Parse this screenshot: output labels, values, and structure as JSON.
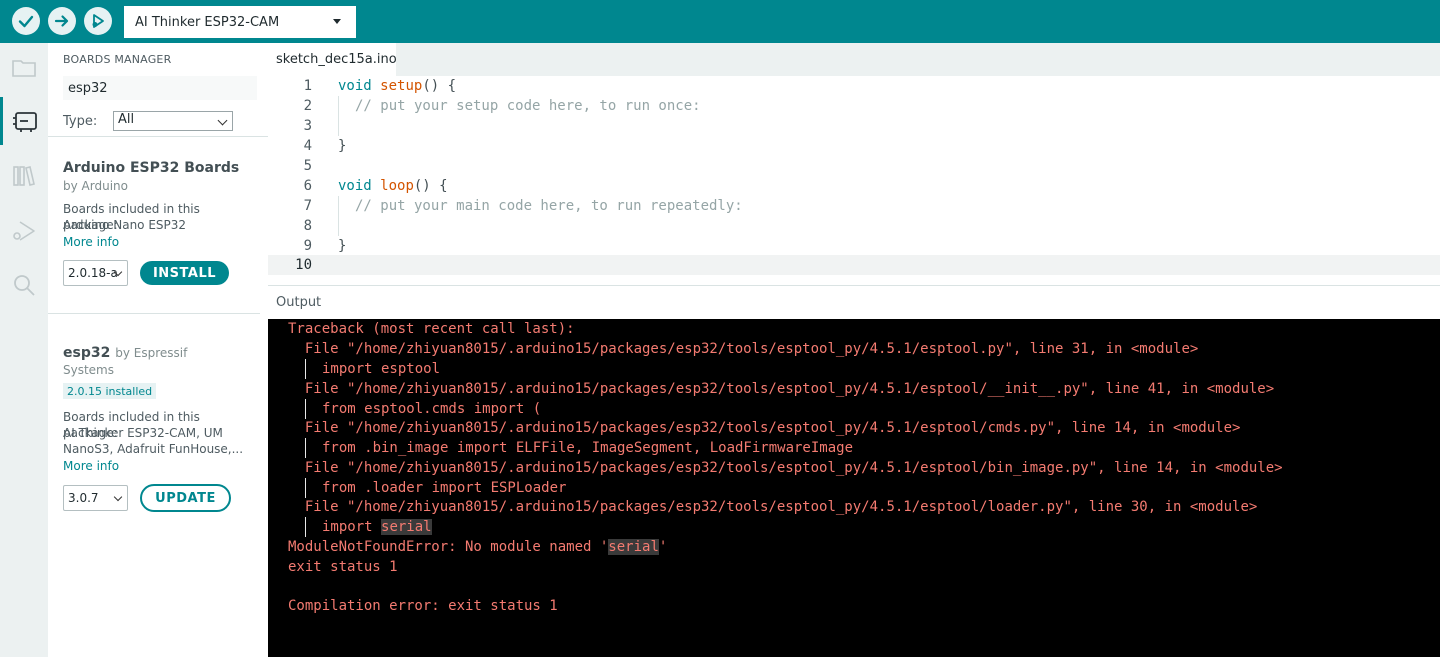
{
  "toolbar": {
    "board": "AI Thinker ESP32-CAM"
  },
  "activity_bar": [
    "folder-icon",
    "boards-icon",
    "library-icon",
    "debug-icon",
    "search-icon"
  ],
  "sidebar": {
    "title": "BOARDS MANAGER",
    "search_value": "esp32",
    "type_label": "Type:",
    "type_value": "All",
    "packages": [
      {
        "name": "Arduino ESP32 Boards",
        "by": "by Arduino",
        "desc_label": "Boards included in this package:",
        "boards": "Arduino Nano ESP32",
        "more": "More info",
        "version": "2.0.18-a",
        "action": "INSTALL"
      },
      {
        "name": "esp32",
        "by_inline": "by Espressif",
        "by_line2": "Systems",
        "installed": "2.0.15 installed",
        "desc_label": "Boards included in this package:",
        "boards": "AI Thinker ESP32-CAM, UM NanoS3, Adafruit FunHouse,...",
        "more": "More info",
        "version": "3.0.7",
        "action": "UPDATE"
      }
    ]
  },
  "editor": {
    "tab": "sketch_dec15a.ino",
    "line_numbers": [
      "1",
      "2",
      "3",
      "4",
      "5",
      "6",
      "7",
      "8",
      "9",
      "10"
    ],
    "code": {
      "l1_kw": "void",
      "l1_fn": "setup",
      "l1_rest": "() {",
      "l2": "// put your setup code here, to run once:",
      "l4": "}",
      "l6_kw": "void",
      "l6_fn": "loop",
      "l6_rest": "() {",
      "l7": "// put your main code here, to run repeatedly:",
      "l9": "}"
    }
  },
  "output": {
    "title": "Output",
    "lines": [
      "Traceback (most recent call last):",
      "  File \"/home/zhiyuan8015/.arduino15/packages/esp32/tools/esptool_py/4.5.1/esptool.py\", line 31, in <module>",
      "import esptool",
      "  File \"/home/zhiyuan8015/.arduino15/packages/esp32/tools/esptool_py/4.5.1/esptool/__init__.py\", line 41, in <module>",
      "from esptool.cmds import (",
      "  File \"/home/zhiyuan8015/.arduino15/packages/esp32/tools/esptool_py/4.5.1/esptool/cmds.py\", line 14, in <module>",
      "from .bin_image import ELFFile, ImageSegment, LoadFirmwareImage",
      "  File \"/home/zhiyuan8015/.arduino15/packages/esp32/tools/esptool_py/4.5.1/esptool/bin_image.py\", line 14, in <module>",
      "from .loader import ESPLoader",
      "  File \"/home/zhiyuan8015/.arduino15/packages/esp32/tools/esptool_py/4.5.1/esptool/loader.py\", line 30, in <module>"
    ],
    "import_prefix": "import ",
    "import_target": "serial",
    "error_prefix": "ModuleNotFoundError: No module named '",
    "error_target": "serial",
    "error_suffix": "'",
    "exit": "exit status 1",
    "compile_error": "Compilation error: exit status 1"
  }
}
